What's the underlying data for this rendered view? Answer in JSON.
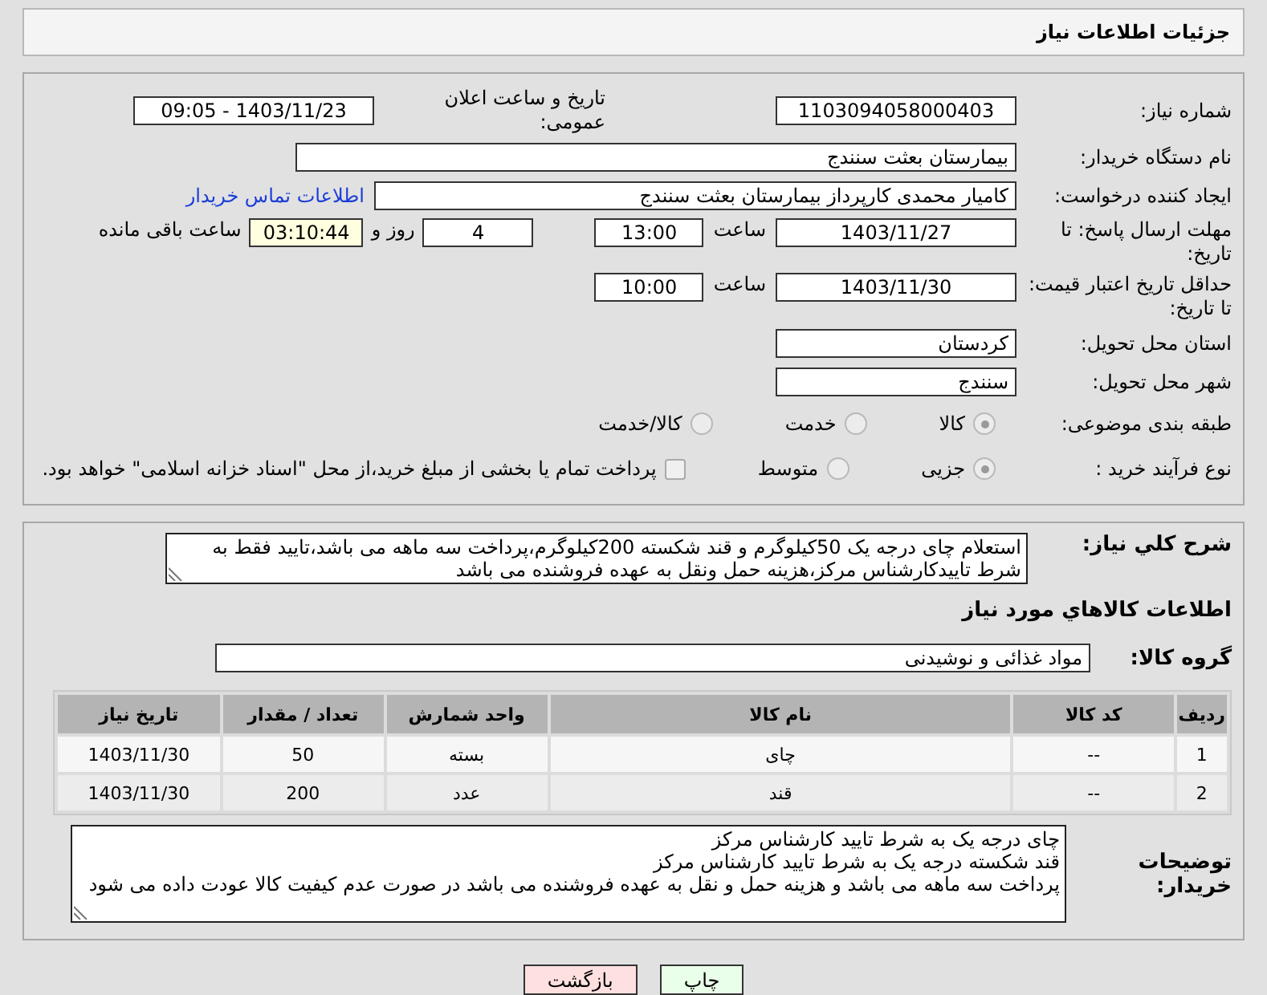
{
  "header": {
    "title": "جزئیات اطلاعات نیاز"
  },
  "need_number": {
    "label": "شماره نیاز:",
    "value": "1103094058000403"
  },
  "announce": {
    "label": "تاریخ و ساعت اعلان عمومی:",
    "value": "1403/11/23 - 09:05"
  },
  "buyer_org": {
    "label": "نام دستگاه خریدار:",
    "value": "بیمارستان بعثت سنندج"
  },
  "requester": {
    "label": "ایجاد کننده درخواست:",
    "value": "کامیار محمدی کارپرداز بیمارستان بعثت سنندج",
    "link": "اطلاعات تماس خریدار"
  },
  "response_deadline": {
    "label": "مهلت ارسال پاسخ: تا تاریخ:",
    "date": "1403/11/27",
    "time_label": "ساعت",
    "time": "13:00",
    "days": "4",
    "days_label": "روز و",
    "remaining": "03:10:44",
    "remaining_label": "ساعت باقی مانده"
  },
  "price_validity": {
    "label": "حداقل تاریخ اعتبار قیمت: تا تاریخ:",
    "date": "1403/11/30",
    "time_label": "ساعت",
    "time": "10:00"
  },
  "province": {
    "label": "استان محل تحویل:",
    "value": "کردستان"
  },
  "city": {
    "label": "شهر محل تحویل:",
    "value": "سنندج"
  },
  "category": {
    "label": "طبقه بندی موضوعی:",
    "options": [
      {
        "label": "کالا",
        "selected": true,
        "disabled": true
      },
      {
        "label": "خدمت",
        "selected": false,
        "disabled": true
      },
      {
        "label": "کالا/خدمت",
        "selected": false,
        "disabled": true
      }
    ]
  },
  "purchase_type": {
    "label": "نوع فرآیند خرید :",
    "options": [
      {
        "label": "جزیی",
        "selected": true,
        "disabled": true
      },
      {
        "label": "متوسط",
        "selected": false,
        "disabled": true
      }
    ],
    "treasury": {
      "checked": false,
      "label": "پرداخت تمام یا بخشی از مبلغ خرید،از محل \"اسناد خزانه اسلامی\" خواهد بود."
    }
  },
  "description": {
    "label": "شرح کلي نياز:",
    "text": "استعلام چای درجه یک 50کیلوگرم و قند شکسته 200کیلوگرم،پرداخت سه ماهه می باشد،تایید فقط به شرط تاییدکارشناس مرکز،هزینه حمل ونقل به عهده فروشنده می باشد"
  },
  "goods_section_title": "اطلاعات کالاهاي مورد نياز",
  "goods_group": {
    "label": "گروه کالا:",
    "value": "مواد غذائی و نوشیدنی"
  },
  "table": {
    "columns": [
      "ردیف",
      "کد کالا",
      "نام کالا",
      "واحد شمارش",
      "تعداد / مقدار",
      "تاریخ نیاز"
    ],
    "rows": [
      [
        "1",
        "--",
        "چای",
        "بسته",
        "50",
        "1403/11/30"
      ],
      [
        "2",
        "--",
        "قند",
        "عدد",
        "200",
        "1403/11/30"
      ]
    ]
  },
  "buyer_notes": {
    "label": "توضیحات خریدار:",
    "lines": [
      "چای درجه یک به شرط تایید کارشناس مرکز",
      "قند شکسته درجه یک به شرط تایید کارشناس مرکز",
      "پرداخت سه ماهه می باشد و هزینه حمل و نقل به عهده فروشنده می باشد در صورت عدم کیفیت کالا عودت داده می شود"
    ]
  },
  "buttons": [
    {
      "label": "چاپ",
      "kind": "print"
    },
    {
      "label": "بازگشت",
      "kind": "back"
    }
  ]
}
